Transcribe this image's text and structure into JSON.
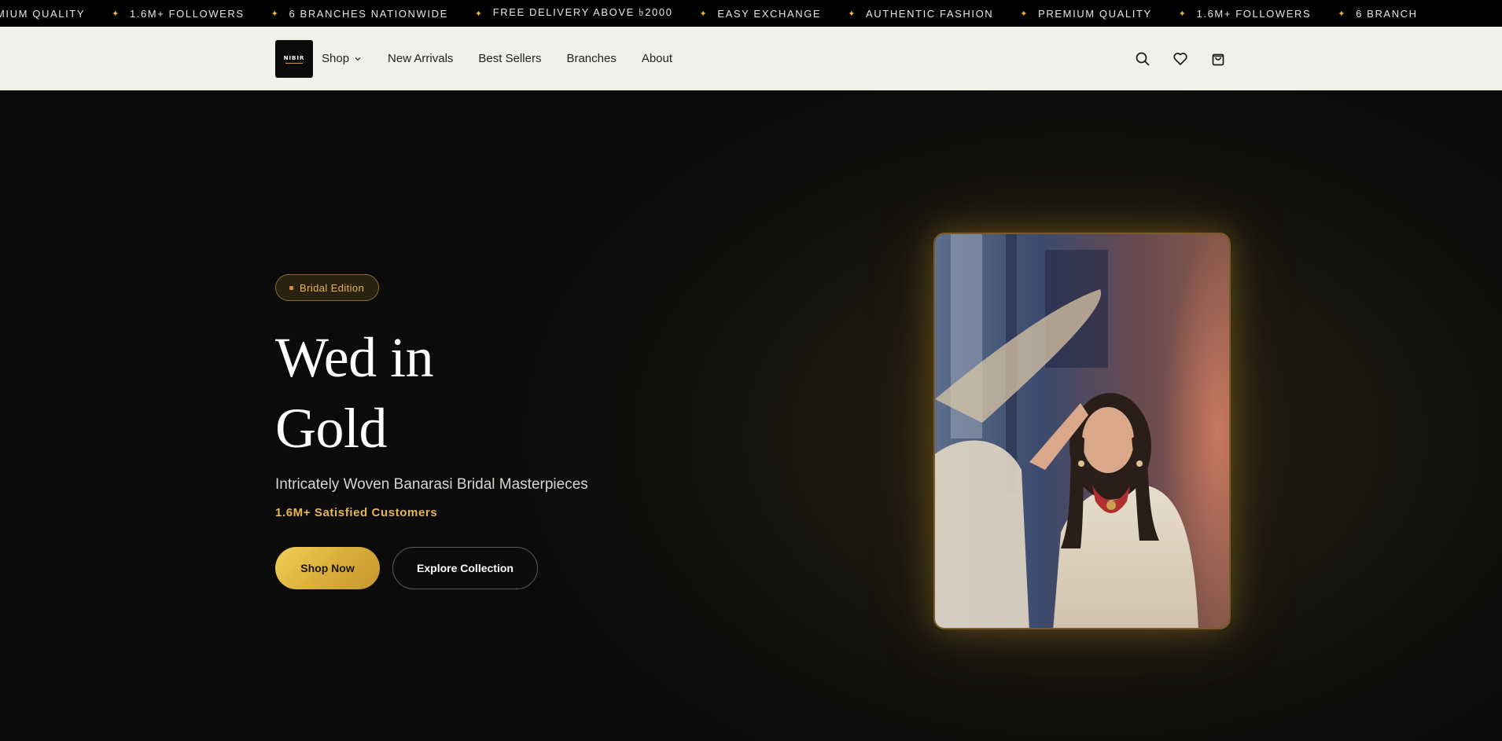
{
  "marquee": {
    "items": [
      "MIUM QUALITY",
      "1.6M+ FOLLOWERS",
      "6 BRANCHES NATIONWIDE",
      "FREE DELIVERY ABOVE ৳2000",
      "EASY EXCHANGE",
      "AUTHENTIC FASHION",
      "PREMIUM QUALITY",
      "1.6M+ FOLLOWERS",
      "6 BRANCH"
    ],
    "star_color": "#e7b64e"
  },
  "header": {
    "logo_text": "NIBIR",
    "nav": {
      "shop": "Shop",
      "new_arrivals": "New Arrivals",
      "best_sellers": "Best Sellers",
      "branches": "Branches",
      "about": "About"
    },
    "icons": [
      "search-icon",
      "heart-icon",
      "shopping-bag-icon"
    ]
  },
  "hero": {
    "badge": "Bridal Edition",
    "title_line1": "Wed in",
    "title_line2": "Gold",
    "subtitle": "Intricately Woven Banarasi Bridal Masterpieces",
    "customers": "1.6M+ Satisfied Customers",
    "primary_button": "Shop Now",
    "secondary_button": "Explore Collection",
    "accent_color": "#e7b64e"
  }
}
